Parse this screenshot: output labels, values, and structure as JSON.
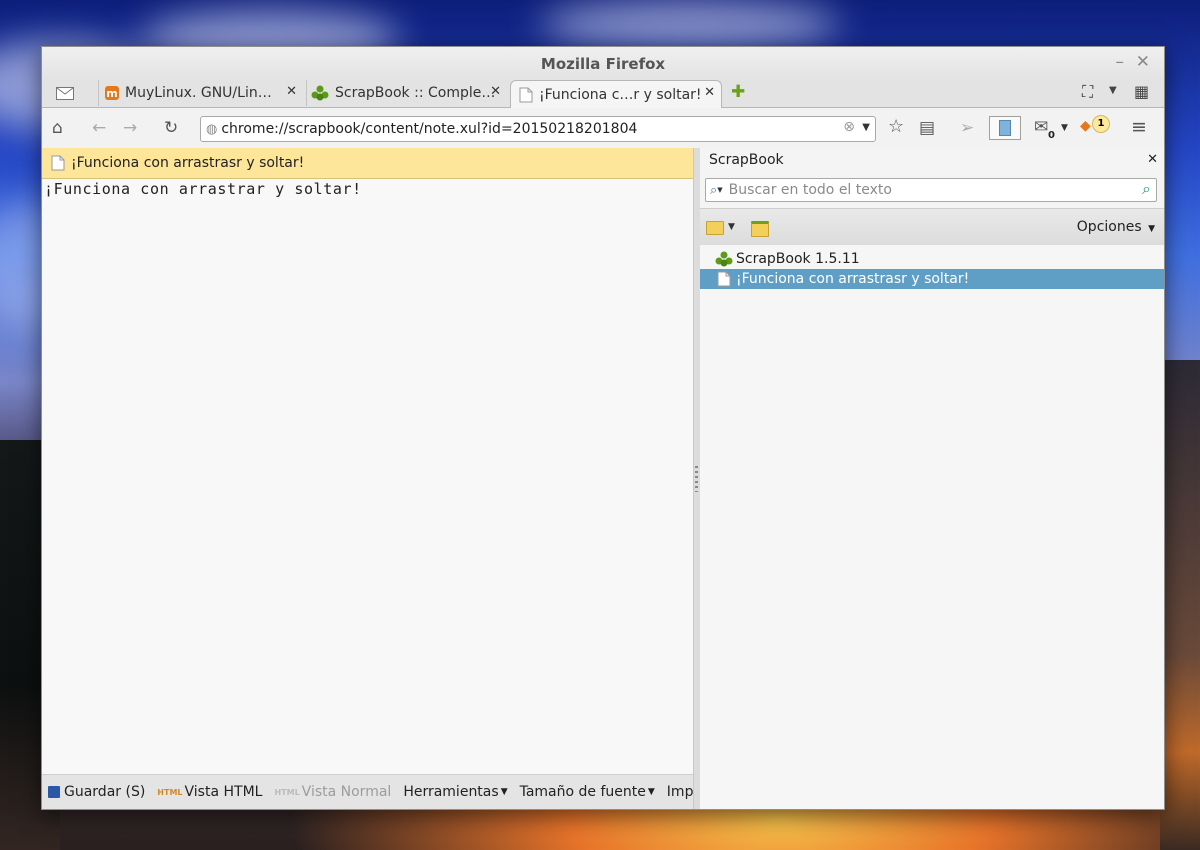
{
  "window": {
    "title": "Mozilla Firefox"
  },
  "tabs": [
    {
      "label": "",
      "icon": "mail-icon"
    },
    {
      "label": "MuyLinux. GNU/Lin…",
      "icon": "muylinux-logo-icon",
      "icon_color": "#e3781d"
    },
    {
      "label": "ScrapBook :: Comple…",
      "icon": "scrapbook-puzzle-icon",
      "icon_color": "#5c9a1a"
    },
    {
      "label": "¡Funciona c…r y soltar!",
      "icon": "page-icon",
      "selected": true
    }
  ],
  "new_tab_glyph": "✚",
  "navbar": {
    "url": "chrome://scrapbook/content/note.xul?id=20150218201804",
    "badge_mail_count": "0",
    "badge_fox_count": "1"
  },
  "note": {
    "title": "¡Funciona con arrastrasr y soltar!",
    "body": "¡Funciona con arrastrar y soltar!"
  },
  "bottombar": {
    "save": "Guardar (S)",
    "view_html": "Vista HTML",
    "view_normal": "Vista Normal",
    "tools": "Herramientas",
    "font_size": "Tamaño de fuente",
    "print": "Imprimir"
  },
  "sidebar": {
    "title": "ScrapBook",
    "search_placeholder": "Buscar en todo el texto",
    "options_label": "Opciones",
    "tree": [
      {
        "label": "ScrapBook 1.5.11",
        "icon": "scrapbook-puzzle-icon"
      },
      {
        "label": "¡Funciona con arrastrasr y soltar!",
        "icon": "page-icon",
        "selected": true
      }
    ]
  },
  "colors": {
    "note_bar": "#fde69a",
    "selection": "#5f9fc6",
    "scrapbook_green": "#5c9a1a"
  }
}
